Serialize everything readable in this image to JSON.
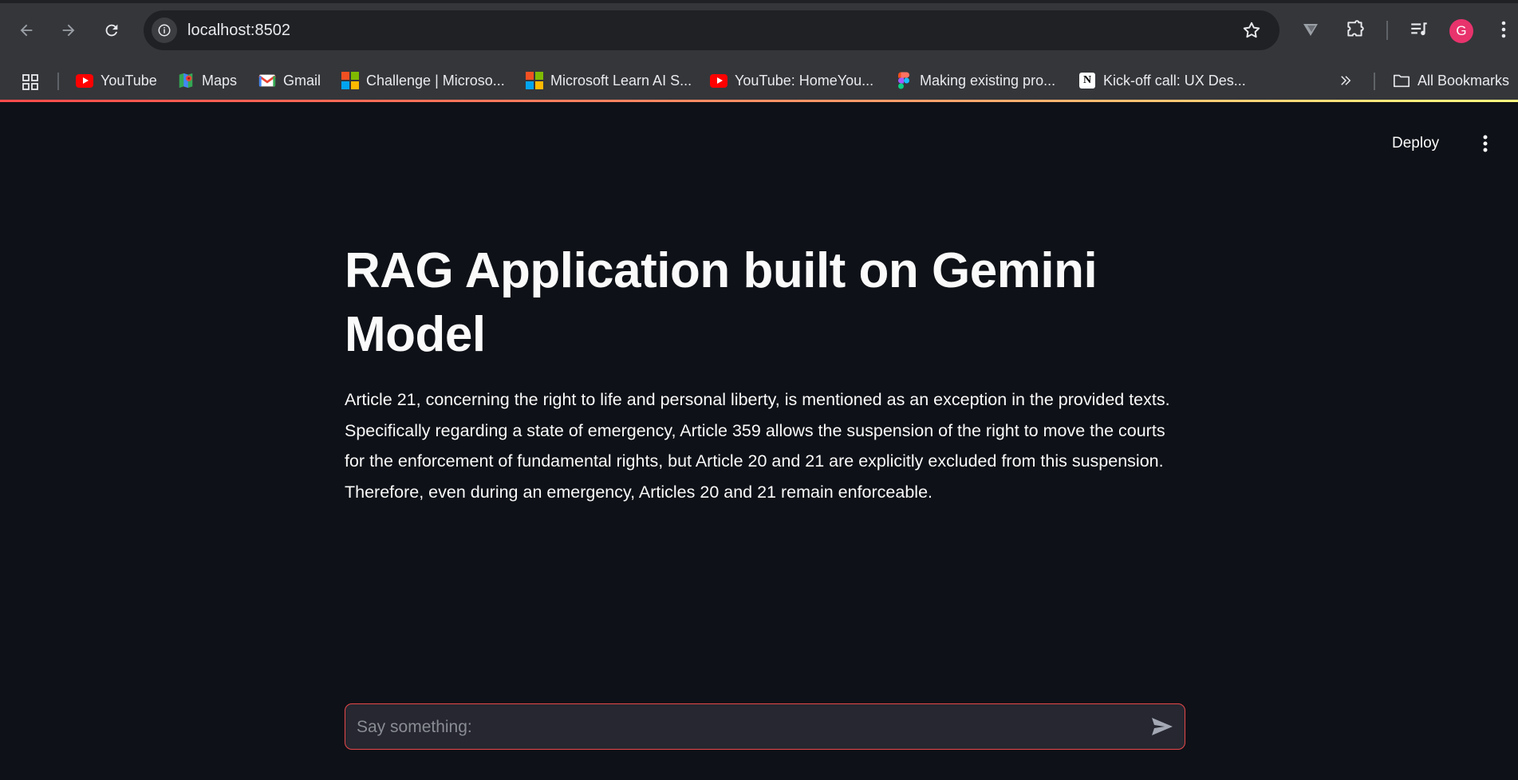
{
  "browser": {
    "url": "localhost:8502",
    "avatar_letter": "G",
    "bookmarks": [
      {
        "label": "YouTube",
        "icon": "youtube-icon"
      },
      {
        "label": "Maps",
        "icon": "maps-icon"
      },
      {
        "label": "Gmail",
        "icon": "gmail-icon"
      },
      {
        "label": "Challenge | Microso...",
        "icon": "microsoft-icon"
      },
      {
        "label": "Microsoft Learn AI S...",
        "icon": "microsoft-icon"
      },
      {
        "label": "YouTube: HomeYou...",
        "icon": "youtube-icon"
      },
      {
        "label": "Making existing pro...",
        "icon": "figma-icon"
      },
      {
        "label": "Kick-off call: UX Des...",
        "icon": "notion-icon"
      }
    ],
    "all_bookmarks_label": "All Bookmarks"
  },
  "app": {
    "deploy_label": "Deploy",
    "title": "RAG Application built on Gemini Model",
    "answer": "Article 21, concerning the right to life and personal liberty, is mentioned as an exception in the provided texts. Specifically regarding a state of emergency, Article 359 allows the suspension of the right to move the courts for the enforcement of fundamental rights, but Article 20 and 21 are explicitly excluded from this suspension. Therefore, even during an emergency, Articles 20 and 21 remain enforceable.",
    "chat_placeholder": "Say something:"
  },
  "colors": {
    "background": "#0e1117",
    "accent": "#ff4b4b",
    "chrome": "#35363a"
  }
}
